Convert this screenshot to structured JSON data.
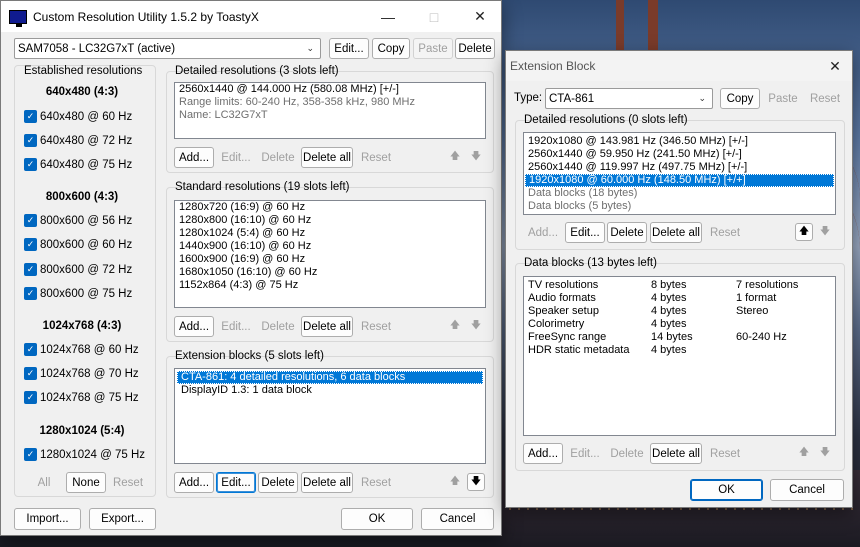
{
  "main": {
    "title": "Custom Resolution Utility 1.5.2 by ToastyX",
    "monitor": "SAM7058 - LC32G7xT (active)",
    "top_buttons": [
      "Edit...",
      "Copy",
      "Paste",
      "Delete"
    ],
    "established": {
      "title": "Established resolutions",
      "groups": [
        {
          "heading": "640x480 (4:3)",
          "items": [
            "640x480 @ 60 Hz",
            "640x480 @ 72 Hz",
            "640x480 @ 75 Hz"
          ]
        },
        {
          "heading": "800x600 (4:3)",
          "items": [
            "800x600 @ 56 Hz",
            "800x600 @ 60 Hz",
            "800x600 @ 72 Hz",
            "800x600 @ 75 Hz"
          ]
        },
        {
          "heading": "1024x768 (4:3)",
          "items": [
            "1024x768 @ 60 Hz",
            "1024x768 @ 70 Hz",
            "1024x768 @ 75 Hz"
          ]
        },
        {
          "heading": "1280x1024 (5:4)",
          "items": [
            "1280x1024 @ 75 Hz"
          ]
        }
      ],
      "buttons": [
        "All",
        "None",
        "Reset"
      ]
    },
    "detailed": {
      "title": "Detailed resolutions (3 slots left)",
      "rows": [
        "2560x1440 @ 144.000 Hz (580.08 MHz) [+/-]",
        "Range limits: 60-240 Hz, 358-358 kHz, 980 MHz",
        "Name: LC32G7xT"
      ],
      "buttons": [
        "Add...",
        "Edit...",
        "Delete",
        "Delete all",
        "Reset"
      ]
    },
    "standard": {
      "title": "Standard resolutions (19 slots left)",
      "rows": [
        "1280x720 (16:9) @ 60 Hz",
        "1280x800 (16:10) @ 60 Hz",
        "1280x1024 (5:4) @ 60 Hz",
        "1440x900 (16:10) @ 60 Hz",
        "1600x900 (16:9) @ 60 Hz",
        "1680x1050 (16:10) @ 60 Hz",
        "1152x864 (4:3) @ 75 Hz"
      ],
      "buttons": [
        "Add...",
        "Edit...",
        "Delete",
        "Delete all",
        "Reset"
      ]
    },
    "extension": {
      "title": "Extension blocks (5 slots left)",
      "rows": [
        "CTA-861: 4 detailed resolutions, 6 data blocks",
        "DisplayID 1.3: 1 data block"
      ],
      "buttons": [
        "Add...",
        "Edit...",
        "Delete",
        "Delete all",
        "Reset"
      ]
    },
    "bottom_buttons": [
      "Import...",
      "Export...",
      "OK",
      "Cancel"
    ]
  },
  "ext": {
    "title": "Extension Block",
    "type_label": "Type:",
    "type_value": "CTA-861",
    "type_buttons": [
      "Copy",
      "Paste",
      "Reset"
    ],
    "detailed": {
      "title": "Detailed resolutions (0 slots left)",
      "rows": [
        "1920x1080 @ 143.981 Hz (346.50 MHz) [+/-]",
        "2560x1440 @ 59.950 Hz (241.50 MHz) [+/-]",
        "2560x1440 @ 119.997 Hz (497.75 MHz) [+/-]",
        "1920x1080 @ 60.000 Hz (148.50 MHz) [+/+]",
        "Data blocks (18 bytes)",
        "Data blocks (5 bytes)"
      ],
      "buttons": [
        "Add...",
        "Edit...",
        "Delete",
        "Delete all",
        "Reset"
      ]
    },
    "datablocks": {
      "title": "Data blocks (13 bytes left)",
      "names": [
        "TV resolutions",
        "Audio formats",
        "Speaker setup",
        "Colorimetry",
        "FreeSync range",
        "HDR static metadata"
      ],
      "bytes": [
        "8 bytes",
        "4 bytes",
        "4 bytes",
        "4 bytes",
        "14 bytes",
        "4 bytes"
      ],
      "info": [
        "7 resolutions",
        "1 format",
        "Stereo",
        "",
        "60-240 Hz",
        ""
      ],
      "buttons": [
        "Add...",
        "Edit...",
        "Delete",
        "Delete all",
        "Reset"
      ]
    },
    "bottom_buttons": [
      "OK",
      "Cancel"
    ]
  }
}
